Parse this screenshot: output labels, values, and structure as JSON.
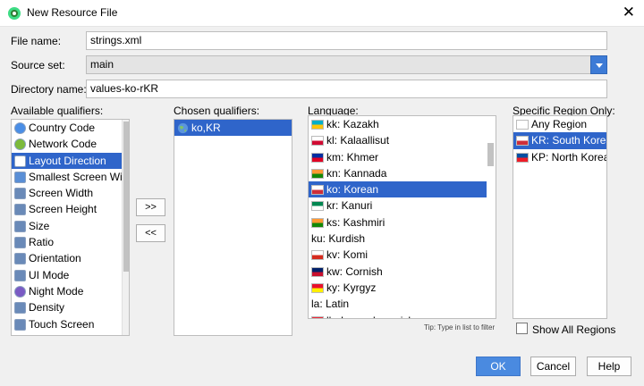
{
  "window": {
    "title": "New Resource File",
    "close_glyph": "✕"
  },
  "form": {
    "file_name_label": "File name:",
    "file_name_value": "strings.xml",
    "source_set_label": "Source set:",
    "source_set_value": "main",
    "directory_name_label": "Directory name:",
    "directory_name_value": "values-ko-rKR"
  },
  "available_qualifiers": {
    "label": "Available qualifiers:",
    "items": [
      {
        "label": "Country Code",
        "icon": "country-code-icon",
        "color": "#4a8ee6"
      },
      {
        "label": "Network Code",
        "icon": "network-code-icon",
        "color": "#7cba3c"
      },
      {
        "label": "Layout Direction",
        "icon": "layout-direction-icon",
        "color": "#ffffff"
      },
      {
        "label": "Smallest Screen Widt",
        "icon": "smallest-screen-width-icon",
        "color": "#5a8fd6"
      },
      {
        "label": "Screen Width",
        "icon": "screen-width-icon",
        "color": "#6a8ab8"
      },
      {
        "label": "Screen Height",
        "icon": "screen-height-icon",
        "color": "#6a8ab8"
      },
      {
        "label": "Size",
        "icon": "size-icon",
        "color": "#6a8ab8"
      },
      {
        "label": "Ratio",
        "icon": "ratio-icon",
        "color": "#6a8ab8"
      },
      {
        "label": "Orientation",
        "icon": "orientation-icon",
        "color": "#6a8ab8"
      },
      {
        "label": "UI Mode",
        "icon": "ui-mode-icon",
        "color": "#6a8ab8"
      },
      {
        "label": "Night Mode",
        "icon": "night-mode-icon",
        "color": "#7a5bc4"
      },
      {
        "label": "Density",
        "icon": "density-icon",
        "color": "#6a8ab8"
      },
      {
        "label": "Touch Screen",
        "icon": "touch-screen-icon",
        "color": "#6a8ab8"
      }
    ]
  },
  "move_buttons": {
    "add": ">>",
    "remove": "<<"
  },
  "chosen_qualifiers": {
    "label": "Chosen qualifiers:",
    "items": [
      {
        "label": "ko,KR",
        "icon": "globe-icon"
      }
    ]
  },
  "language": {
    "label": "Language:",
    "items": [
      {
        "label": "kk: Kazakh",
        "icon": "flag-kazakhstan-icon",
        "flag": [
          "#00afca",
          "#fec50c"
        ]
      },
      {
        "label": "kl: Kalaallisut",
        "icon": "flag-greenland-icon",
        "flag": [
          "#ffffff",
          "#d00c33"
        ]
      },
      {
        "label": "km: Khmer",
        "icon": "flag-cambodia-icon",
        "flag": [
          "#032ea1",
          "#e00025"
        ]
      },
      {
        "label": "kn: Kannada",
        "icon": "flag-india-icon",
        "flag": [
          "#ff9933",
          "#138808"
        ]
      },
      {
        "label": "ko: Korean",
        "icon": "flag-korea-icon",
        "flag": [
          "#ffffff",
          "#cd2e3a"
        ]
      },
      {
        "label": "kr: Kanuri",
        "icon": "flag-nigeria-icon",
        "flag": [
          "#008751",
          "#ffffff"
        ]
      },
      {
        "label": "ks: Kashmiri",
        "icon": "flag-india-icon",
        "flag": [
          "#ff9933",
          "#138808"
        ]
      },
      {
        "label": "ku: Kurdish",
        "icon": "",
        "flag": []
      },
      {
        "label": "kv: Komi",
        "icon": "flag-russia-icon",
        "flag": [
          "#ffffff",
          "#d52b1e"
        ]
      },
      {
        "label": "kw: Cornish",
        "icon": "flag-uk-icon",
        "flag": [
          "#012169",
          "#c8102e"
        ]
      },
      {
        "label": "ky: Kyrgyz",
        "icon": "flag-kyrgyzstan-icon",
        "flag": [
          "#e8112d",
          "#ffef00"
        ]
      },
      {
        "label": "la: Latin",
        "icon": "",
        "flag": []
      },
      {
        "label": "lb: Luxembourgish",
        "icon": "flag-luxembourg-icon",
        "flag": [
          "#ed2939",
          "#00a1de"
        ]
      }
    ],
    "tip": "Tip: Type in list to filter"
  },
  "region": {
    "label": "Specific Region Only:",
    "items": [
      {
        "label": "Any Region",
        "icon": "blank-flag-icon",
        "flag": [
          "#ffffff",
          "#ffffff"
        ]
      },
      {
        "label": "KR: South Korea",
        "icon": "flag-korea-icon",
        "flag": [
          "#ffffff",
          "#cd2e3a"
        ]
      },
      {
        "label": "KP: North Korea",
        "icon": "flag-north-korea-icon",
        "flag": [
          "#024fa2",
          "#ed1c27"
        ]
      }
    ],
    "show_all_label": "Show All Regions"
  },
  "buttons": {
    "ok": "OK",
    "cancel": "Cancel",
    "help": "Help"
  },
  "colors": {
    "selection": "#2f65ca",
    "primary_button": "#4a8ae0",
    "dropdown_button": "#3d7bd6"
  }
}
